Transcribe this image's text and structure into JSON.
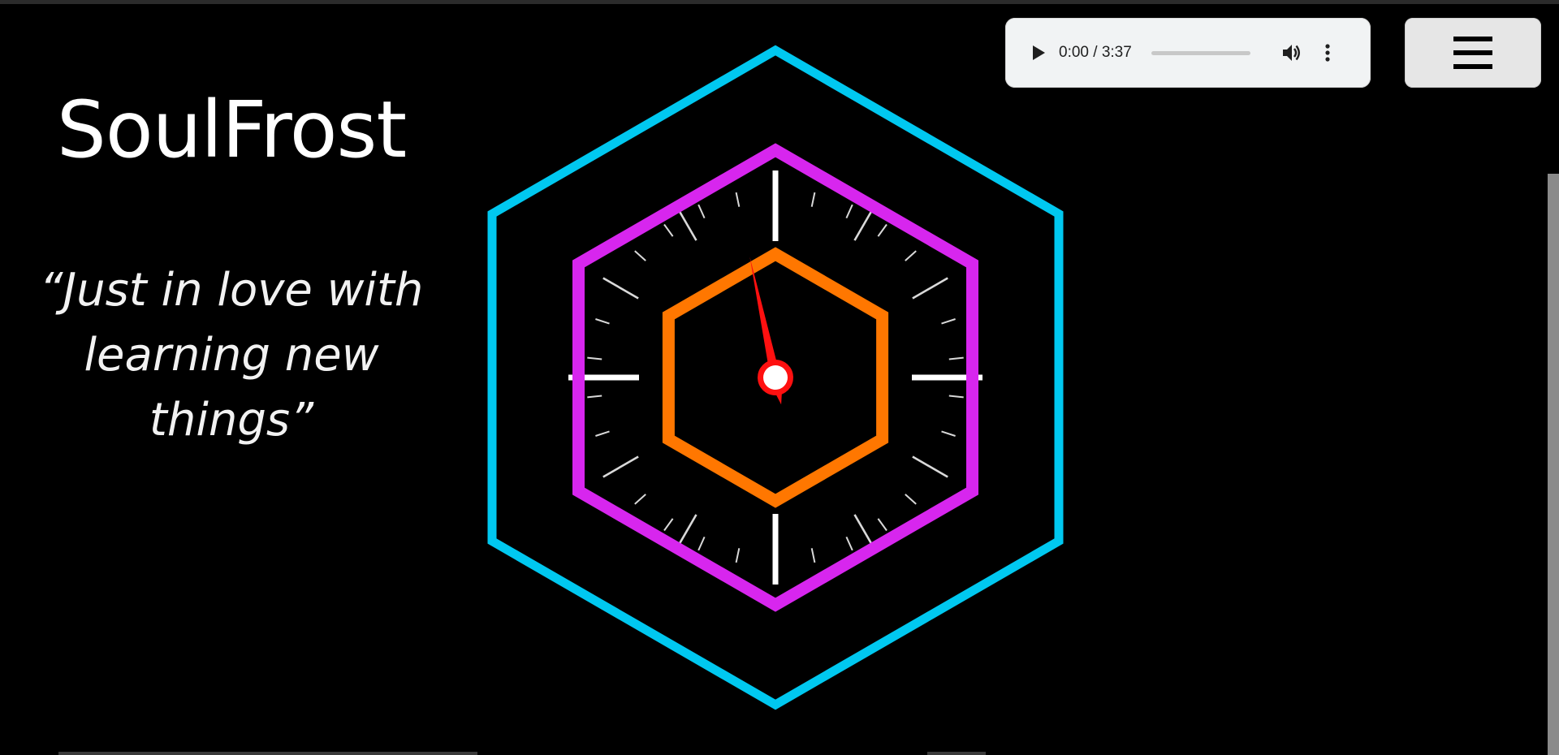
{
  "site": {
    "title": "SoulFrost",
    "quote": "“Just in love with learning new things”"
  },
  "audio": {
    "time_display": "0:00 / 3:37",
    "progress": 0.0,
    "icons": [
      "play-icon",
      "volume-icon",
      "more-options-icon"
    ]
  },
  "menu": {
    "icon": "hamburger-menu-icon"
  },
  "clock": {
    "hand_angle_degrees": -12,
    "colors": {
      "outer_hexagon": "#00c8f0",
      "middle_hexagon": "#d726ee",
      "inner_hexagon": "#ff7700",
      "hand": "#ff1010",
      "ticks": "#ffffff"
    }
  }
}
